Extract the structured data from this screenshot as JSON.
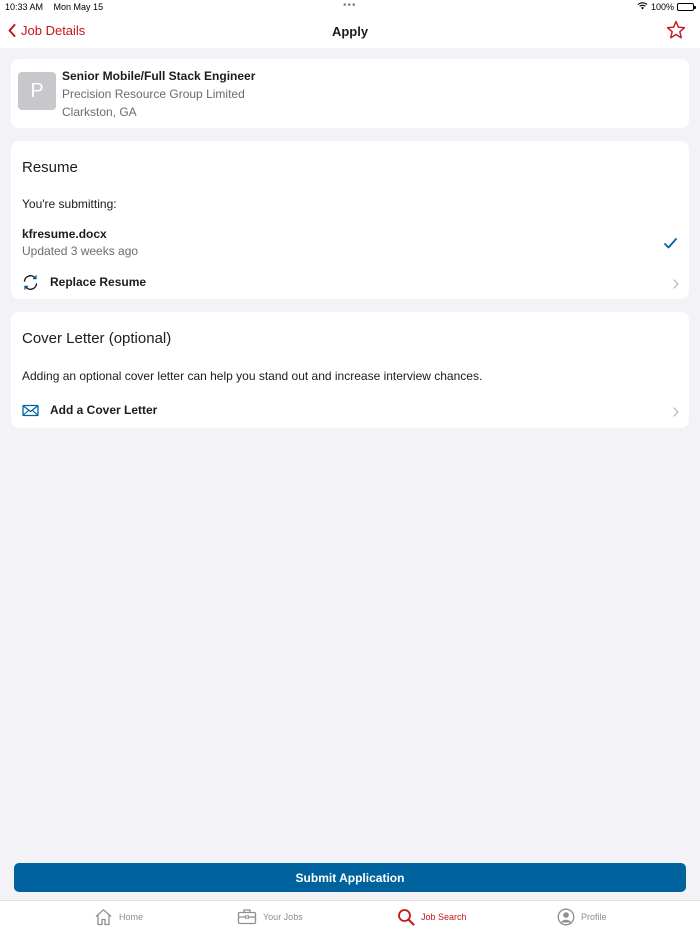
{
  "status_bar": {
    "time": "10:33 AM",
    "date": "Mon May 15",
    "dots": "•••",
    "battery": "100%"
  },
  "nav": {
    "back_label": "Job Details",
    "title": "Apply",
    "star_icon": "star-outline-icon"
  },
  "job": {
    "logo_letter": "P",
    "title": "Senior Mobile/Full Stack Engineer",
    "company": "Precision Resource Group Limited",
    "location": "Clarkston, GA"
  },
  "resume": {
    "section_title": "Resume",
    "submitting_label": "You're submitting:",
    "file_name": "kfresume.docx",
    "file_updated": "Updated 3 weeks ago",
    "replace_label": "Replace Resume"
  },
  "cover_letter": {
    "section_title": "Cover Letter (optional)",
    "description": "Adding an optional cover letter can help you stand out and increase interview chances.",
    "add_label": "Add a Cover Letter"
  },
  "submit_label": "Submit Application",
  "tabs": [
    {
      "label": "Home",
      "icon": "house-icon",
      "active": false
    },
    {
      "label": "Your Jobs",
      "icon": "briefcase-icon",
      "active": false
    },
    {
      "label": "Job Search",
      "icon": "magnifier-icon",
      "active": true
    },
    {
      "label": "Profile",
      "icon": "person-circle-icon",
      "active": false
    }
  ],
  "colors": {
    "accent": "#c4161c",
    "primary_button": "#00639e",
    "background": "#f2f2f7",
    "check": "#00639e"
  }
}
